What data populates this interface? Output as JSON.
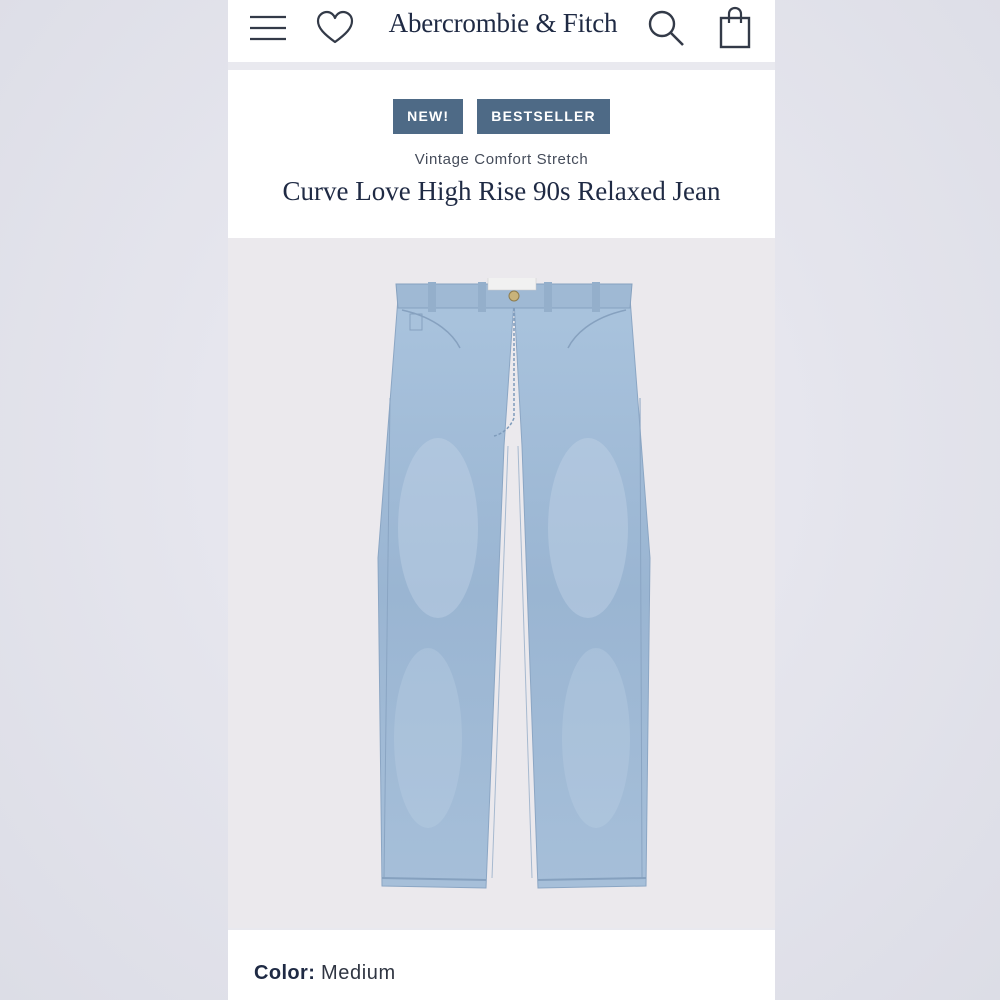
{
  "header": {
    "brand": "Abercrombie & Fitch",
    "icons": [
      "menu-icon",
      "heart-icon",
      "search-icon",
      "bag-icon"
    ]
  },
  "product": {
    "badges": [
      "NEW!",
      "BESTSELLER"
    ],
    "collection": "Vintage Comfort Stretch",
    "title": "Curve Love High Rise 90s Relaxed Jean",
    "image": "light-wash-jeans-image"
  },
  "color": {
    "label": "Color:",
    "value": "Medium"
  },
  "colors": {
    "brand_navy": "#1f2a44",
    "badge_blue": "#4e6a86",
    "denim": "#9fbad6"
  }
}
